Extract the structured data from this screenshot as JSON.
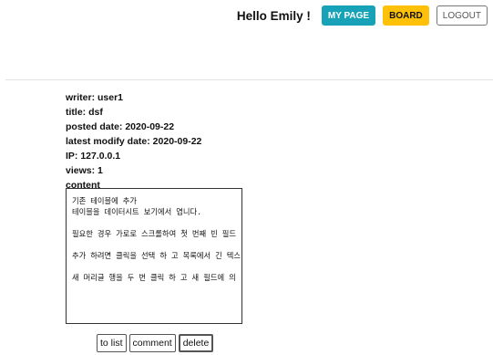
{
  "header": {
    "greeting": "Hello Emily !",
    "mypage_label": "MY PAGE",
    "board_label": "BOARD",
    "logout_label": "LOGOUT"
  },
  "post": {
    "writer": "writer: user1",
    "title": "title: dsf",
    "posted_date": "posted date: 2020-09-22",
    "latest_modify_date": "latest modify date: 2020-09-22",
    "ip": "IP: 127.0.0.1",
    "views": "views: 1",
    "content_label": "content",
    "content_lines": [
      "기존 테이블에 추가",
      "테이블을 데이터시트 보기에서 엽니다.",
      "",
      "필요한 경우 가로로 스크롤하여 첫 번째 빈 필드",
      "",
      "추가 하려면 클릭을 선택 하 고 목록에서 긴 텍스",
      "",
      "새 머리글 행을 두 번 클릭 하 고 새 필드에 의"
    ]
  },
  "actions": {
    "to_list_label": "to list",
    "comment_label": "comment",
    "delete_label": "delete"
  },
  "colors": {
    "mypage": "#17a2b8",
    "board": "#ffc107"
  }
}
